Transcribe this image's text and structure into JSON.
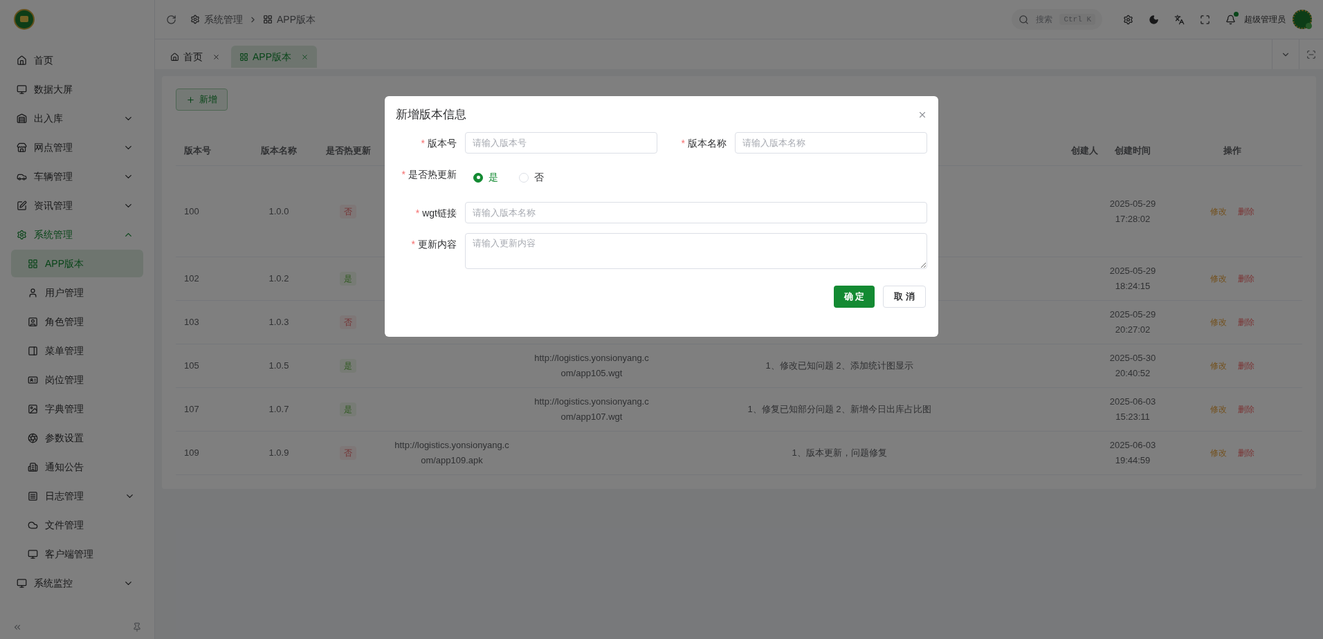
{
  "header": {
    "breadcrumb": [
      {
        "label": "系统管理"
      },
      {
        "label": "APP版本"
      }
    ],
    "search": {
      "label": "搜索",
      "shortcut": "Ctrl K"
    },
    "notifications": {
      "unread": true
    },
    "user": {
      "name": "超级管理员",
      "online": true
    }
  },
  "tabs": [
    {
      "label": "首页",
      "selected": false
    },
    {
      "label": "APP版本",
      "selected": true
    }
  ],
  "sidebar": {
    "items": [
      {
        "label": "首页",
        "kind": "link",
        "selected": false
      },
      {
        "label": "数据大屏",
        "kind": "link",
        "selected": false
      },
      {
        "label": "出入库",
        "kind": "group",
        "expanded": false,
        "selected": false
      },
      {
        "label": "网点管理",
        "kind": "group",
        "expanded": false,
        "selected": false
      },
      {
        "label": "车辆管理",
        "kind": "group",
        "expanded": false,
        "selected": false
      },
      {
        "label": "资讯管理",
        "kind": "group",
        "expanded": false,
        "selected": false
      },
      {
        "label": "系统管理",
        "kind": "group",
        "expanded": true,
        "selected": true,
        "children": [
          {
            "label": "APP版本",
            "kind": "link",
            "selected": true
          },
          {
            "label": "用户管理",
            "kind": "link",
            "selected": false
          },
          {
            "label": "角色管理",
            "kind": "link",
            "selected": false
          },
          {
            "label": "菜单管理",
            "kind": "link",
            "selected": false
          },
          {
            "label": "岗位管理",
            "kind": "link",
            "selected": false
          },
          {
            "label": "字典管理",
            "kind": "link",
            "selected": false
          },
          {
            "label": "参数设置",
            "kind": "link",
            "selected": false
          },
          {
            "label": "通知公告",
            "kind": "link",
            "selected": false
          },
          {
            "label": "日志管理",
            "kind": "group",
            "expanded": false,
            "selected": false
          },
          {
            "label": "文件管理",
            "kind": "link",
            "selected": false
          },
          {
            "label": "客户端管理",
            "kind": "link",
            "selected": false
          }
        ]
      },
      {
        "label": "系统监控",
        "kind": "group",
        "expanded": false,
        "selected": false
      }
    ]
  },
  "toolbar": {
    "add_button": "新增"
  },
  "table": {
    "columns": {
      "version": "版本号",
      "name": "版本名称",
      "hot": "是否热更新",
      "creator": "创建人",
      "created": "创建时间",
      "actions": "操作"
    },
    "rows": [
      {
        "version": "100",
        "name": "1.0.0",
        "hot": false,
        "hot_label": "否",
        "created": "2025-05-29 17:28:02",
        "edit": "修改",
        "delete": "删除"
      },
      {
        "version": "102",
        "name": "1.0.2",
        "hot": true,
        "hot_label": "是",
        "created": "2025-05-29 18:24:15",
        "edit": "修改",
        "delete": "删除"
      },
      {
        "version": "103",
        "name": "1.0.3",
        "hot": false,
        "hot_label": "否",
        "created": "2025-05-29 20:27:02",
        "edit": "修改",
        "delete": "删除"
      },
      {
        "version": "105",
        "name": "1.0.5",
        "hot": true,
        "hot_label": "是",
        "wgt_link": "http://logistics.yonsionyang.com/app105.wgt",
        "content": "1、修改已知问题 2、添加统计图显示",
        "created": "2025-05-30 20:40:52",
        "edit": "修改",
        "delete": "删除"
      },
      {
        "version": "107",
        "name": "1.0.7",
        "hot": true,
        "hot_label": "是",
        "wgt_link": "http://logistics.yonsionyang.com/app107.wgt",
        "content": "1、修复已知部分问题 2、新增今日出库占比图",
        "created": "2025-06-03 15:23:11",
        "edit": "修改",
        "delete": "删除"
      },
      {
        "version": "109",
        "name": "1.0.9",
        "hot": false,
        "hot_label": "否",
        "apk_link": "http://logistics.yonsionyang.com/app109.apk",
        "content": "1、版本更新，问题修复",
        "created": "2025-06-03 19:44:59",
        "edit": "修改",
        "delete": "删除"
      }
    ]
  },
  "dialog": {
    "title": "新增版本信息",
    "rows": [
      {
        "fields": [
          {
            "kind": "input",
            "label": "版本号",
            "required_mark": "*",
            "placeholder": "请输入版本号"
          },
          {
            "kind": "input",
            "label": "版本名称",
            "required_mark": "*",
            "placeholder": "请输入版本名称"
          }
        ]
      },
      {
        "fields": [
          {
            "kind": "radio",
            "label": "是否热更新",
            "required_mark": "*",
            "options": [
              {
                "label": "是",
                "selected": true
              },
              {
                "label": "否",
                "selected": false
              }
            ]
          }
        ]
      },
      {
        "fields": [
          {
            "kind": "input",
            "label": "wgt链接",
            "required_mark": "*",
            "placeholder": "请输入版本名称"
          }
        ]
      },
      {
        "fields": [
          {
            "kind": "textarea",
            "label": "更新内容",
            "required_mark": "*",
            "placeholder": "请输入更新内容"
          }
        ]
      }
    ],
    "buttons": [
      {
        "label": "确 定",
        "kind": "primary"
      },
      {
        "label": "取 消",
        "kind": "default"
      }
    ]
  }
}
